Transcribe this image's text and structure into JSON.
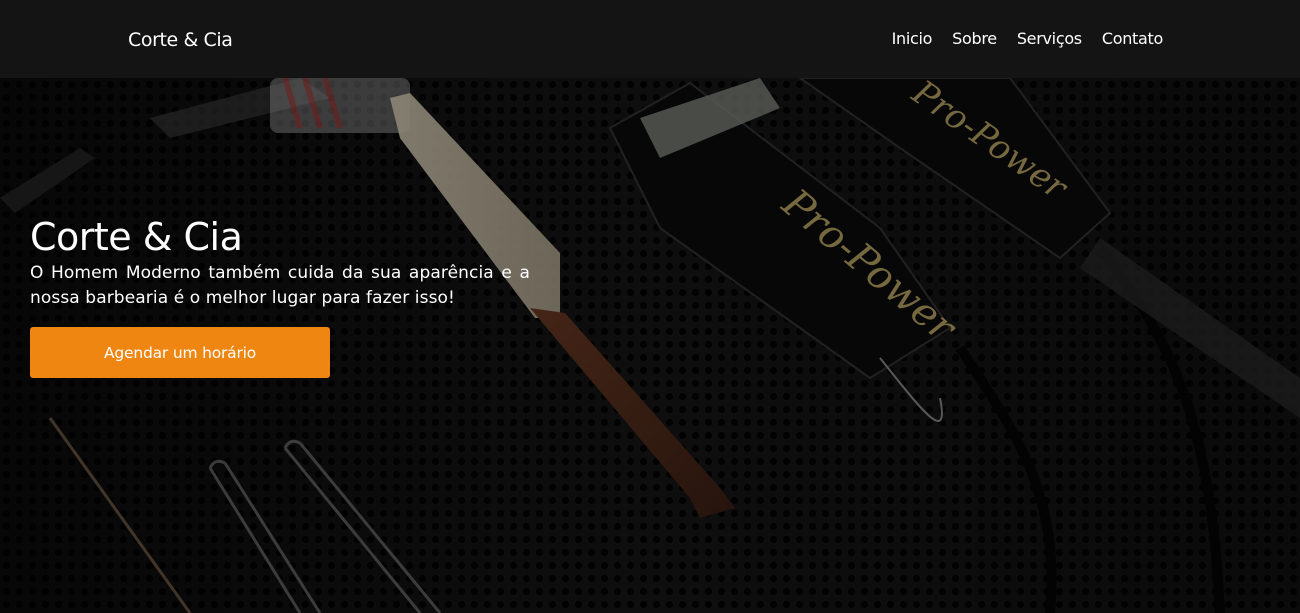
{
  "header": {
    "brand": "Corte & Cia",
    "nav": [
      "Inicio",
      "Sobre",
      "Serviços",
      "Contato"
    ]
  },
  "hero": {
    "title": "Corte & Cia",
    "text": "O Homem Moderno também cuida da sua aparência e a nossa barbearia é o melhor lugar para fazer isso!",
    "cta_label": "Agendar um horário",
    "clipper_brand": "Pro-Power"
  },
  "colors": {
    "header_bg": "#141414",
    "accent": "#ef8612",
    "text": "#ffffff"
  }
}
